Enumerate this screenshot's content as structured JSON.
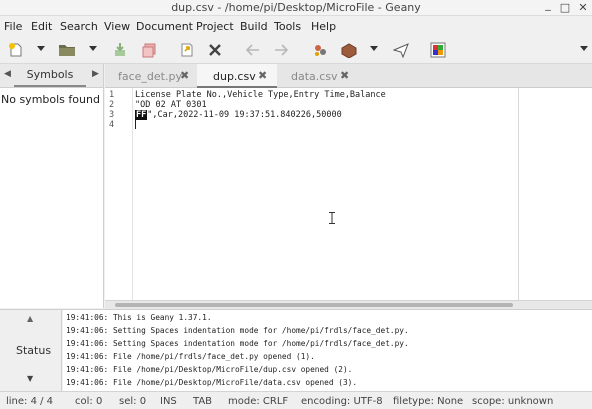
{
  "window": {
    "title": "dup.csv - /home/pi/Desktop/MicroFile - Geany",
    "controls": {
      "minimize": "_",
      "maximize": "□",
      "close": "✕"
    }
  },
  "menu": [
    "File",
    "Edit",
    "Search",
    "View",
    "Document",
    "Project",
    "Build",
    "Tools",
    "Help"
  ],
  "toolbar": {
    "icons": [
      "new-file-icon",
      "open-file-icon",
      "save-icon",
      "save-all-icon",
      "revert-icon",
      "close-file-icon",
      "back-icon",
      "forward-icon",
      "compile-icon",
      "build-icon",
      "run-icon",
      "color-chooser-icon",
      "more-icon"
    ]
  },
  "sidebar": {
    "tab_label": "Symbols",
    "left_arrow": "◀",
    "right_arrow": "▶",
    "empty_text": "No symbols found"
  },
  "tabs": [
    {
      "label": "face_det.py",
      "close": "✖",
      "active": false
    },
    {
      "label": "dup.csv",
      "close": "✖",
      "active": true
    },
    {
      "label": "data.csv",
      "close": "✖",
      "active": false
    }
  ],
  "editor": {
    "line_numbers": [
      "1",
      "2",
      "3",
      "4"
    ],
    "lines": {
      "l1": "License Plate No.,Vehicle Type,Entry Time,Balance",
      "l2": "\"OD 02 AT 0301",
      "l3_ctrl": "FF",
      "l3_rest": "\",Car,2022-11-09 19:37:51.840226,50000",
      "l4": ""
    }
  },
  "messages": {
    "label": "Status",
    "up": "▲",
    "down": "▼",
    "lines": [
      "19:41:06: This is Geany 1.37.1.",
      "19:41:06: Setting Spaces indentation mode for /home/pi/frdls/face_det.py.",
      "19:41:06: Setting Spaces indentation mode for /home/pi/frdls/face_det.py.",
      "19:41:06: File /home/pi/frdls/face_det.py opened (1).",
      "19:41:06: File /home/pi/Desktop/MicroFile/dup.csv opened (2).",
      "19:41:06: File /home/pi/Desktop/MicroFile/data.csv opened (3)."
    ]
  },
  "status": {
    "line": "line: 4 / 4",
    "col": "col: 0",
    "sel": "sel: 0",
    "ins": "INS",
    "tab": "TAB",
    "mode": "mode: CRLF",
    "encoding": "encoding: UTF-8",
    "filetype": "filetype: None",
    "scope": "scope: unknown"
  }
}
